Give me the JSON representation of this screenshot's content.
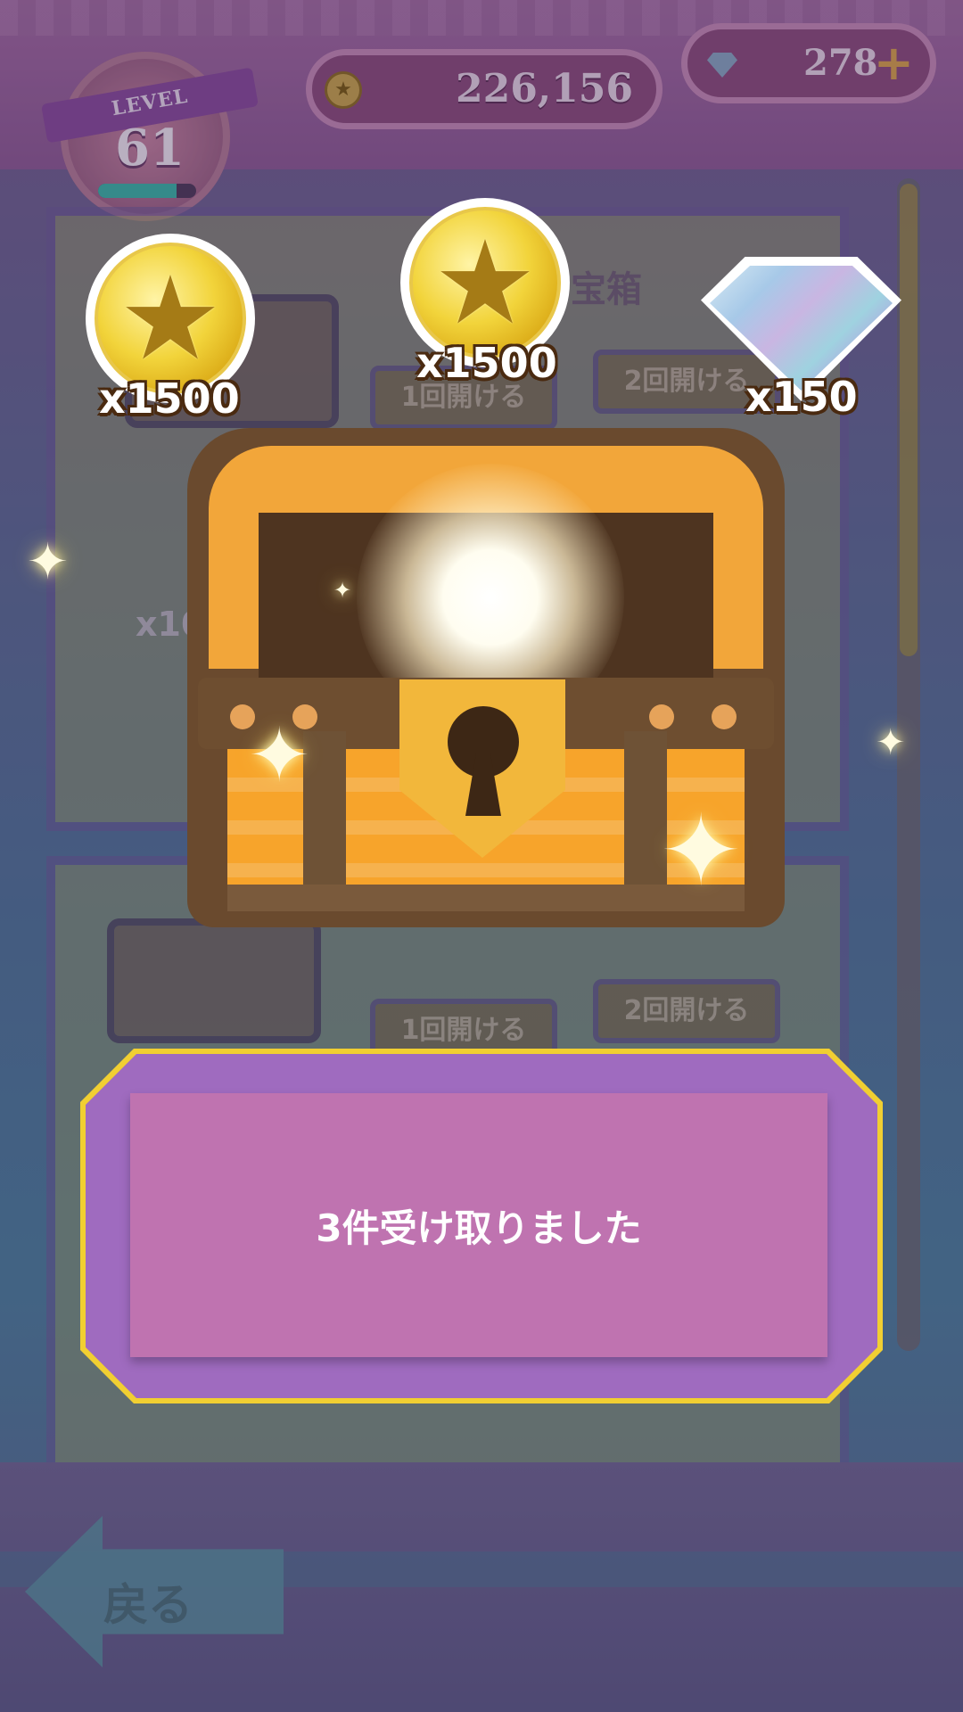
{
  "header": {
    "level_label": "LEVEL",
    "level_value": "61",
    "level_progress": 0.8,
    "coins": "226,156",
    "gems": "278",
    "gems_add": "+"
  },
  "background": {
    "panel_title": "宝箱",
    "open_once_label": "1回開ける",
    "open_twice_label": "2回開ける",
    "partial_gem_qty": "x10"
  },
  "rewards": [
    {
      "icon": "star-coin-icon",
      "qty": "x1500"
    },
    {
      "icon": "star-coin-icon",
      "qty": "x1500"
    },
    {
      "icon": "gem-icon",
      "qty": "x150"
    }
  ],
  "dialog": {
    "message": "3件受け取りました"
  },
  "nav": {
    "back_label": "戻る"
  },
  "colors": {
    "dialog_border": "#f1cf32",
    "dialog_fill": "#9f6bbf",
    "dialog_card": "#bf73b0",
    "chest_orange": "#f7a42b",
    "coin_gold": "#f2d43b"
  }
}
